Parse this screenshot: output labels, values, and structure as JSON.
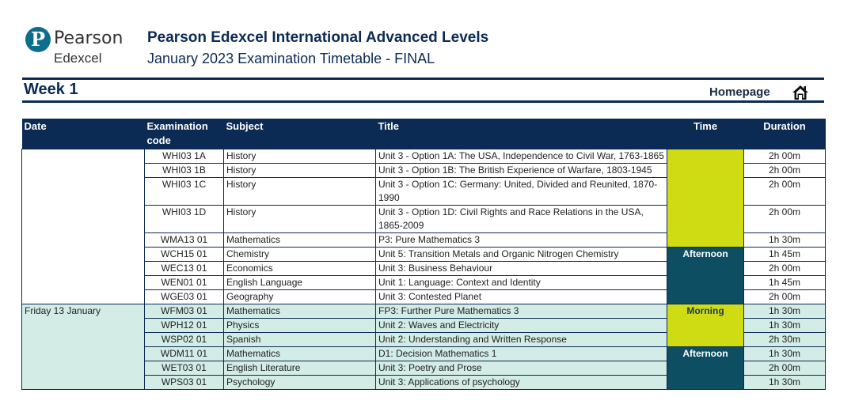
{
  "brand": {
    "mark": "P",
    "name_line1": "Pearson",
    "name_line2": "Edexcel"
  },
  "document": {
    "title": "Pearson Edexcel International Advanced Levels",
    "subtitle": "January 2023 Examination Timetable - FINAL"
  },
  "week": {
    "title": "Week 1",
    "homepage_label": "Homepage",
    "home_icon": "home-icon"
  },
  "colors": {
    "navy": "#0b2a54",
    "morning_slot": "#cfdc14",
    "afternoon_slot": "#0e4e62",
    "alt_row": "#d3ece6"
  },
  "table": {
    "headers": {
      "date": "Date",
      "code": "Examination code",
      "subject": "Subject",
      "title": "Title",
      "time": "Time",
      "duration": "Duration"
    },
    "group1": {
      "date": "",
      "slots": {
        "morning": "",
        "afternoon": "Afternoon"
      },
      "rows": [
        {
          "code": "WHI03 1A",
          "subject": "History",
          "title": "Unit 3 - Option 1A: The USA, Independence to Civil War, 1763-1865",
          "duration": "2h 00m"
        },
        {
          "code": "WHI03 1B",
          "subject": "History",
          "title": "Unit 3 - Option 1B: The British Experience of Warfare, 1803-1945",
          "duration": "2h 00m"
        },
        {
          "code": "WHI03 1C",
          "subject": "History",
          "title": "Unit 3 - Option 1C: Germany: United, Divided and Reunited, 1870-1990",
          "duration": "2h 00m"
        },
        {
          "code": "WHI03 1D",
          "subject": "History",
          "title": "Unit 3 - Option 1D: Civil Rights and Race Relations in the USA, 1865-2009",
          "duration": "2h 00m"
        },
        {
          "code": "WMA13 01",
          "subject": "Mathematics",
          "title": "P3: Pure Mathematics 3",
          "duration": "1h 30m"
        },
        {
          "code": "WCH15 01",
          "subject": "Chemistry",
          "title": "Unit 5: Transition Metals and Organic Nitrogen Chemistry",
          "duration": "1h 45m"
        },
        {
          "code": "WEC13 01",
          "subject": "Economics",
          "title": "Unit 3: Business Behaviour",
          "duration": "2h 00m"
        },
        {
          "code": "WEN01 01",
          "subject": "English Language",
          "title": "Unit 1: Language: Context and Identity",
          "duration": "1h 45m"
        },
        {
          "code": "WGE03 01",
          "subject": "Geography",
          "title": "Unit 3: Contested Planet",
          "duration": "2h 00m"
        }
      ]
    },
    "group2": {
      "date": "Friday 13 January",
      "slots": {
        "morning": "Morning",
        "afternoon": "Afternoon"
      },
      "rows": [
        {
          "code": "WFM03 01",
          "subject": "Mathematics",
          "title": "FP3: Further Pure Mathematics 3",
          "duration": "1h 30m"
        },
        {
          "code": "WPH12 01",
          "subject": "Physics",
          "title": "Unit 2: Waves and Electricity",
          "duration": "1h 30m"
        },
        {
          "code": "WSP02 01",
          "subject": "Spanish",
          "title": "Unit 2: Understanding and Written Response",
          "duration": "2h 30m"
        },
        {
          "code": "WDM11 01",
          "subject": "Mathematics",
          "title": "D1: Decision Mathematics 1",
          "duration": "1h 30m"
        },
        {
          "code": "WET03 01",
          "subject": "English Literature",
          "title": "Unit 3: Poetry and Prose",
          "duration": "2h 00m"
        },
        {
          "code": "WPS03 01",
          "subject": "Psychology",
          "title": "Unit 3: Applications of psychology",
          "duration": "1h 30m"
        }
      ]
    }
  }
}
